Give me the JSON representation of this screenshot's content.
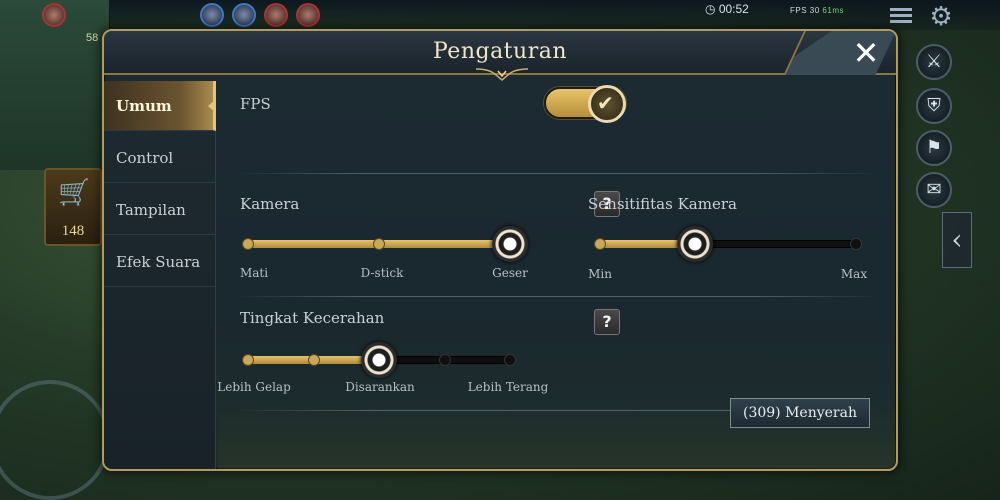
{
  "dialog": {
    "title": "Pengaturan",
    "close_icon": "close-icon",
    "sidebar": [
      {
        "label": "Umum",
        "active": true
      },
      {
        "label": "Control",
        "active": false
      },
      {
        "label": "Tampilan",
        "active": false
      },
      {
        "label": "Efek Suara",
        "active": false
      }
    ],
    "fps": {
      "label": "FPS",
      "enabled": true
    },
    "camera": {
      "label": "Kamera",
      "help": "?",
      "options": [
        "Mati",
        "D-stick",
        "Geser"
      ],
      "selected_index": 2
    },
    "camera_sensitivity": {
      "label": "Sensitifitas Kamera",
      "min_label": "Min",
      "max_label": "Max",
      "value": 0.37
    },
    "brightness": {
      "label": "Tingkat Kecerahan",
      "help": "?",
      "labels": [
        "Lebih Gelap",
        "Disarankan",
        "Lebih Terang"
      ],
      "steps": 5,
      "selected_index": 2
    },
    "surrender_button": "(309)  Menyerah"
  },
  "hud": {
    "clock": "00:52",
    "fps_readout": "FPS 30",
    "ping": "61ms",
    "gold": "148",
    "badge": "58",
    "colors": {
      "accent_gold": "#e2c47c",
      "enemy": "#aa3333",
      "ally": "#3a79c9"
    }
  }
}
